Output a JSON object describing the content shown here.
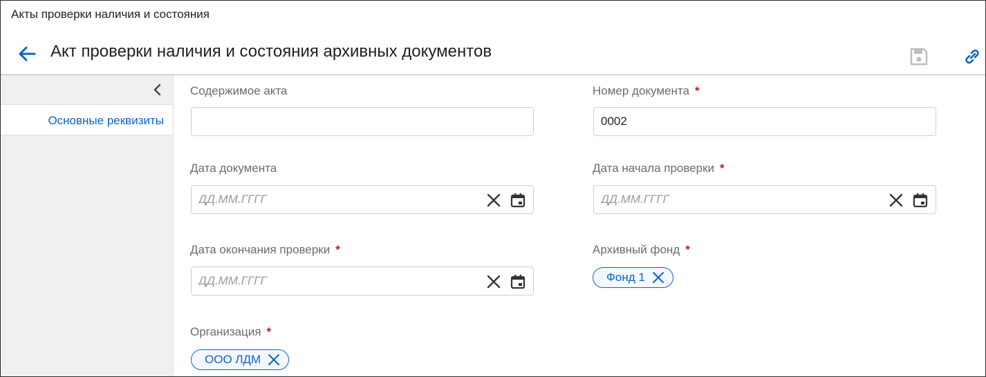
{
  "breadcrumb": "Акты проверки наличия и состояния",
  "title": "Акт проверки наличия и состояния архивных документов",
  "icons": {
    "back": "arrow-left-icon",
    "save": "save-icon",
    "link": "link-icon",
    "collapse": "chevron-left-icon",
    "clear": "close-icon",
    "calendar": "calendar-icon",
    "chip_remove": "close-icon"
  },
  "colors": {
    "accent": "#0b63c5",
    "required": "#b71c1c",
    "label": "#6b6b6b",
    "sidebar_bg": "#f0f0f0",
    "disabled_icon": "#bdbdbd"
  },
  "sidebar": {
    "items": [
      {
        "label": "Основные реквизиты",
        "active": true
      }
    ]
  },
  "form": {
    "required_mark": "*",
    "content": {
      "label": "Содержимое акта",
      "value": "",
      "required": false
    },
    "doc_number": {
      "label": "Номер документа",
      "value": "0002",
      "required": true
    },
    "doc_date": {
      "label": "Дата документа",
      "placeholder": "ДД.ММ.ГГГГ",
      "required": false
    },
    "check_start": {
      "label": "Дата начала проверки",
      "placeholder": "ДД.ММ.ГГГГ",
      "required": true
    },
    "check_end": {
      "label": "Дата окончания проверки",
      "placeholder": "ДД.ММ.ГГГГ",
      "required": true
    },
    "fund": {
      "label": "Архивный фонд",
      "required": true,
      "chips": [
        "Фонд 1"
      ]
    },
    "organization": {
      "label": "Организация",
      "required": true,
      "chips": [
        "ООО ЛДМ"
      ]
    }
  }
}
